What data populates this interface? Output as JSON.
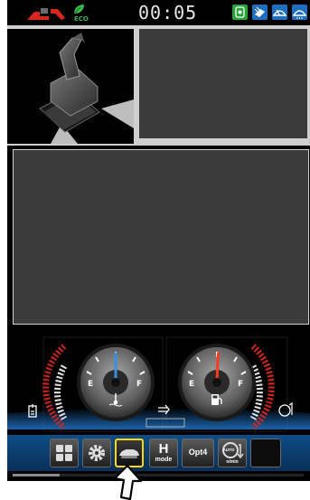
{
  "status_bar": {
    "clock": "00:05",
    "eco_label": "ECO",
    "icons": [
      "excavator-mode-icon",
      "eco-leaf-icon",
      "auto-idle-icon",
      "work-light-icon",
      "wiper-icon",
      "washer-icon"
    ]
  },
  "camera_panels": [
    "machine-overhead-view",
    "camera-view-top-right",
    "camera-view-main"
  ],
  "gauges": {
    "left": {
      "name": "coolant-temperature-gauge",
      "low_label": "E",
      "high_label": "F",
      "needle_level": 0.5
    },
    "right": {
      "name": "fuel-gauge",
      "low_label": "E",
      "high_label": "F",
      "needle_level": 0.52
    }
  },
  "menu": {
    "buttons": [
      {
        "name": "menu-grid-button",
        "label": ""
      },
      {
        "name": "settings-button",
        "label": ""
      },
      {
        "name": "travel-speed-button",
        "label": "",
        "selected": true
      },
      {
        "name": "h-mode-button",
        "label": "H",
        "sublabel": "mode"
      },
      {
        "name": "opt4-button",
        "label": "Opt4"
      },
      {
        "name": "auto-rpm-button",
        "label": "AUTO",
        "sublabel": "n/min"
      },
      {
        "name": "blank-button",
        "label": ""
      }
    ]
  },
  "colors": {
    "accent_blue": "#1e6fbf",
    "selected_outline": "#ffd800",
    "needle_left": "#3a8ee8",
    "needle_right": "#ff3b1f",
    "eco_green": "#3ab54a",
    "warning_red": "#d9261c"
  }
}
